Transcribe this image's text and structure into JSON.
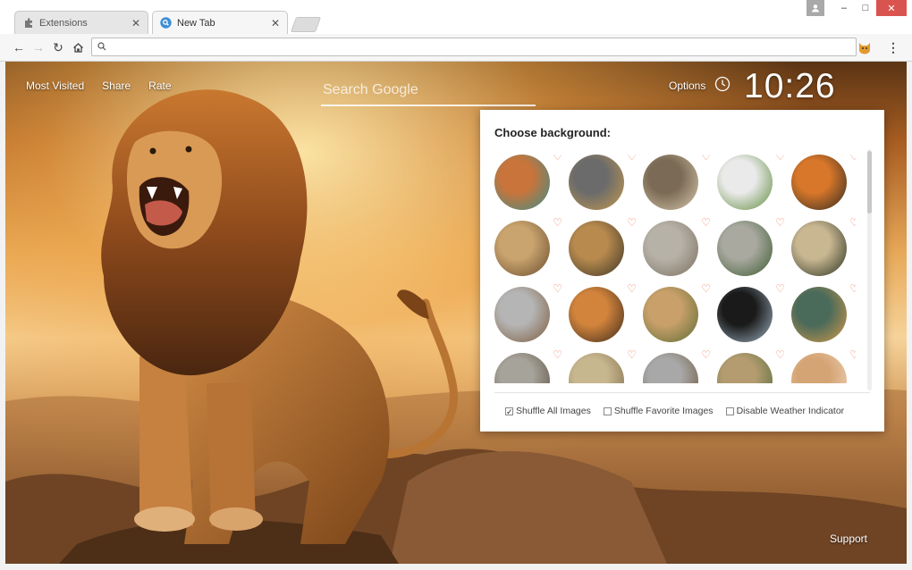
{
  "tabs": [
    {
      "title": "Extensions",
      "icon": "puzzle-icon",
      "active": false
    },
    {
      "title": "New Tab",
      "icon": "search-icon",
      "active": true
    }
  ],
  "toolbar": {
    "address_value": ""
  },
  "page": {
    "top_links": [
      "Most Visited",
      "Share",
      "Rate"
    ],
    "search_placeholder": "Search Google",
    "options_label": "Options",
    "clock": "10:26",
    "support_label": "Support"
  },
  "popup": {
    "title": "Choose background:",
    "thumbnails": [
      {
        "icon": "lion-face-thumbnail",
        "palette": [
          "#c8743b",
          "#3a8f8a"
        ]
      },
      {
        "icon": "tiger-walking-thumbnail",
        "palette": [
          "#6b6b6b",
          "#c69a4e"
        ]
      },
      {
        "icon": "lion-sketch-thumbnail",
        "palette": [
          "#7b6a55",
          "#d8c9ad"
        ]
      },
      {
        "icon": "white-tiger-cub-thumbnail",
        "palette": [
          "#eaeaea",
          "#5c8a3a"
        ]
      },
      {
        "icon": "tiger-face-thumbnail",
        "palette": [
          "#d8772a",
          "#2f2a20"
        ]
      },
      {
        "icon": "wildcat-snarl-thumbnail",
        "palette": [
          "#c9a46e",
          "#6b4c2e"
        ]
      },
      {
        "icon": "leopard-cubs-thumbnail",
        "palette": [
          "#b88a4e",
          "#3a3426"
        ]
      },
      {
        "icon": "lynx-thumbnail",
        "palette": [
          "#b7b2a8",
          "#7a6e5e"
        ]
      },
      {
        "icon": "snow-leopard-thumbnail",
        "palette": [
          "#a9a9a0",
          "#3b5a2f"
        ]
      },
      {
        "icon": "cheetah-face-thumbnail",
        "palette": [
          "#c9b792",
          "#26301f"
        ]
      },
      {
        "icon": "tigers-snow-thumbnail",
        "palette": [
          "#b5b5b5",
          "#7c5a3a"
        ]
      },
      {
        "icon": "tiger-running-thumbnail",
        "palette": [
          "#d2843c",
          "#3b2a1c"
        ]
      },
      {
        "icon": "cub-forest-thumbnail",
        "palette": [
          "#c9a06a",
          "#5d6b35"
        ]
      },
      {
        "icon": "white-tiger-dark-thumbnail",
        "palette": [
          "#1a1a1a",
          "#9fb3c2"
        ]
      },
      {
        "icon": "tiger-water-thumbnail",
        "palette": [
          "#4a6a5a",
          "#d59a4a"
        ]
      },
      {
        "icon": "snow-leopard-cub-thumbnail",
        "palette": [
          "#a6a39a",
          "#5a4d3e"
        ]
      },
      {
        "icon": "cheetah-grass-thumbnail",
        "palette": [
          "#c7b78f",
          "#7f6a4a"
        ]
      },
      {
        "icon": "leopard-rest-thumbnail",
        "palette": [
          "#a8a8a8",
          "#6b5436"
        ]
      },
      {
        "icon": "cheetahs-pair-thumbnail",
        "palette": [
          "#b49c70",
          "#4f6a3a"
        ]
      },
      {
        "icon": "puma-thumbnail",
        "palette": [
          "#d5a474",
          "#efd7bd"
        ]
      }
    ],
    "options": [
      {
        "label": "Shuffle All Images",
        "checked": true
      },
      {
        "label": "Shuffle Favorite Images",
        "checked": false
      },
      {
        "label": "Disable Weather Indicator",
        "checked": false
      }
    ]
  },
  "colors": {
    "accent_heart": "#f08a6e",
    "window_close": "#d9534f"
  }
}
